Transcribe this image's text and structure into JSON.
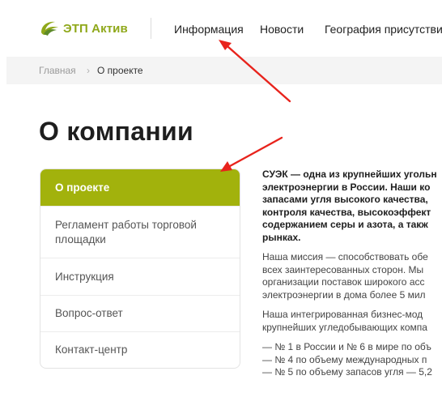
{
  "header": {
    "logo_text": "ЭТП Актив",
    "nav": [
      "Информация",
      "Новости",
      "География присутствия"
    ]
  },
  "breadcrumb": {
    "home": "Главная",
    "separator": "›",
    "current": "О проекте"
  },
  "page_title": "О компании",
  "sidebar": {
    "items": [
      {
        "label": "О проекте",
        "active": true
      },
      {
        "label": "Регламент работы торговой площадки",
        "active": false
      },
      {
        "label": "Инструкция",
        "active": false
      },
      {
        "label": "Вопрос-ответ",
        "active": false
      },
      {
        "label": "Контакт-центр",
        "active": false
      }
    ]
  },
  "content": {
    "lead": [
      "СУЭК — одна из крупнейших угольн",
      "электроэнергии в России. Наши ко",
      "запасами угля высокого качества,",
      "контроля качества, высокоэффект",
      "содержанием серы и азота, а такж",
      "рынках."
    ],
    "mission": [
      "Наша миссия — способствовать обе",
      "всех заинтересованных сторон. Мы",
      "организации поставок широкого асс",
      "электроэнергии в дома более 5 мил"
    ],
    "model": [
      "Наша интегрированная бизнес-мод",
      "крупнейших угледобывающих компа"
    ],
    "facts": [
      "— № 1 в России и № 6 в мире по объ",
      "— № 4 по объему международных п",
      "— № 5 по объему запасов угля — 5,2"
    ]
  },
  "colors": {
    "accent": "#a2b20c",
    "logo": "#8fa81a",
    "annotation_arrow": "#e8231c"
  }
}
